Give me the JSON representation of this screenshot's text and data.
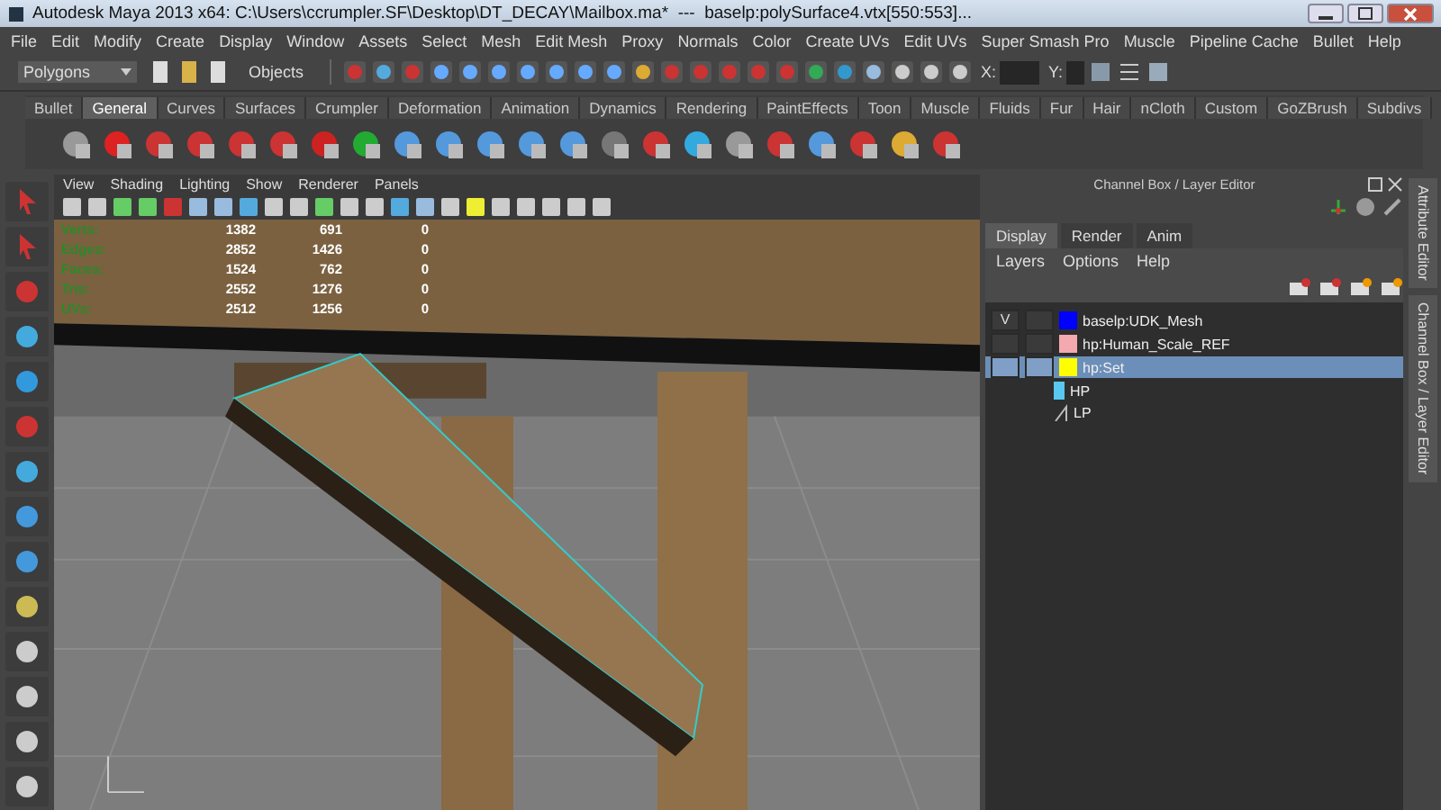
{
  "window": {
    "title": "Autodesk Maya 2013 x64: C:\\Users\\ccrumpler.SF\\Desktop\\DT_DECAY\\Mailbox.ma*  ---  baselp:polySurface4.vtx[550:553]..."
  },
  "menu": [
    "File",
    "Edit",
    "Modify",
    "Create",
    "Display",
    "Window",
    "Assets",
    "Select",
    "Mesh",
    "Edit Mesh",
    "Proxy",
    "Normals",
    "Color",
    "Create UVs",
    "Edit UVs",
    "Super Smash Pro",
    "Muscle",
    "Pipeline Cache",
    "Bullet",
    "Help"
  ],
  "status_line": {
    "menu_set": "Polygons",
    "mask": "Objects",
    "x_label": "X:",
    "y_label": "Y:"
  },
  "shelf_tabs": [
    {
      "label": "Bullet",
      "selected": false
    },
    {
      "label": "General",
      "selected": true
    },
    {
      "label": "Curves",
      "selected": false
    },
    {
      "label": "Surfaces",
      "selected": false
    },
    {
      "label": "Crumpler",
      "selected": false
    },
    {
      "label": "Deformation",
      "selected": false
    },
    {
      "label": "Animation",
      "selected": false
    },
    {
      "label": "Dynamics",
      "selected": false
    },
    {
      "label": "Rendering",
      "selected": false
    },
    {
      "label": "PaintEffects",
      "selected": false
    },
    {
      "label": "Toon",
      "selected": false
    },
    {
      "label": "Muscle",
      "selected": false
    },
    {
      "label": "Fluids",
      "selected": false
    },
    {
      "label": "Fur",
      "selected": false
    },
    {
      "label": "Hair",
      "selected": false
    },
    {
      "label": "nCloth",
      "selected": false
    },
    {
      "label": "Custom",
      "selected": false
    },
    {
      "label": "GoZBrush",
      "selected": false
    },
    {
      "label": "Subdivs",
      "selected": false
    }
  ],
  "viewport": {
    "menu": [
      "View",
      "Shading",
      "Lighting",
      "Show",
      "Renderer",
      "Panels"
    ],
    "hud": [
      {
        "label": "Verts:",
        "values": [
          "1382",
          "691",
          "0"
        ]
      },
      {
        "label": "Edges:",
        "values": [
          "2852",
          "1426",
          "0"
        ]
      },
      {
        "label": "Faces:",
        "values": [
          "1524",
          "762",
          "0"
        ]
      },
      {
        "label": "Tris:",
        "values": [
          "2552",
          "1276",
          "0"
        ]
      },
      {
        "label": "UVs:",
        "values": [
          "2512",
          "1256",
          "0"
        ]
      }
    ]
  },
  "channel_box": {
    "title": "Channel Box / Layer Editor",
    "tabs": [
      {
        "label": "Display",
        "selected": true
      },
      {
        "label": "Render",
        "selected": false
      },
      {
        "label": "Anim",
        "selected": false
      }
    ],
    "menu": [
      "Layers",
      "Options",
      "Help"
    ],
    "layers": [
      {
        "kind": "layer",
        "visible": "V",
        "name": "baselp:UDK_Mesh",
        "color": "#0000ff",
        "selected": false
      },
      {
        "kind": "layer",
        "name": "hp:Human_Scale_REF",
        "color": "#f4a8b0",
        "selected": false
      },
      {
        "kind": "layer",
        "name": "hp:Set",
        "color": "#ffff00",
        "selected": true
      },
      {
        "kind": "sub",
        "name": "HP",
        "color": "#58c8f0",
        "selected": false
      },
      {
        "kind": "sub",
        "name": "LP",
        "selected": false
      }
    ]
  },
  "side_tabs": [
    "Attribute Editor",
    "Channel Box / Layer Editor"
  ]
}
